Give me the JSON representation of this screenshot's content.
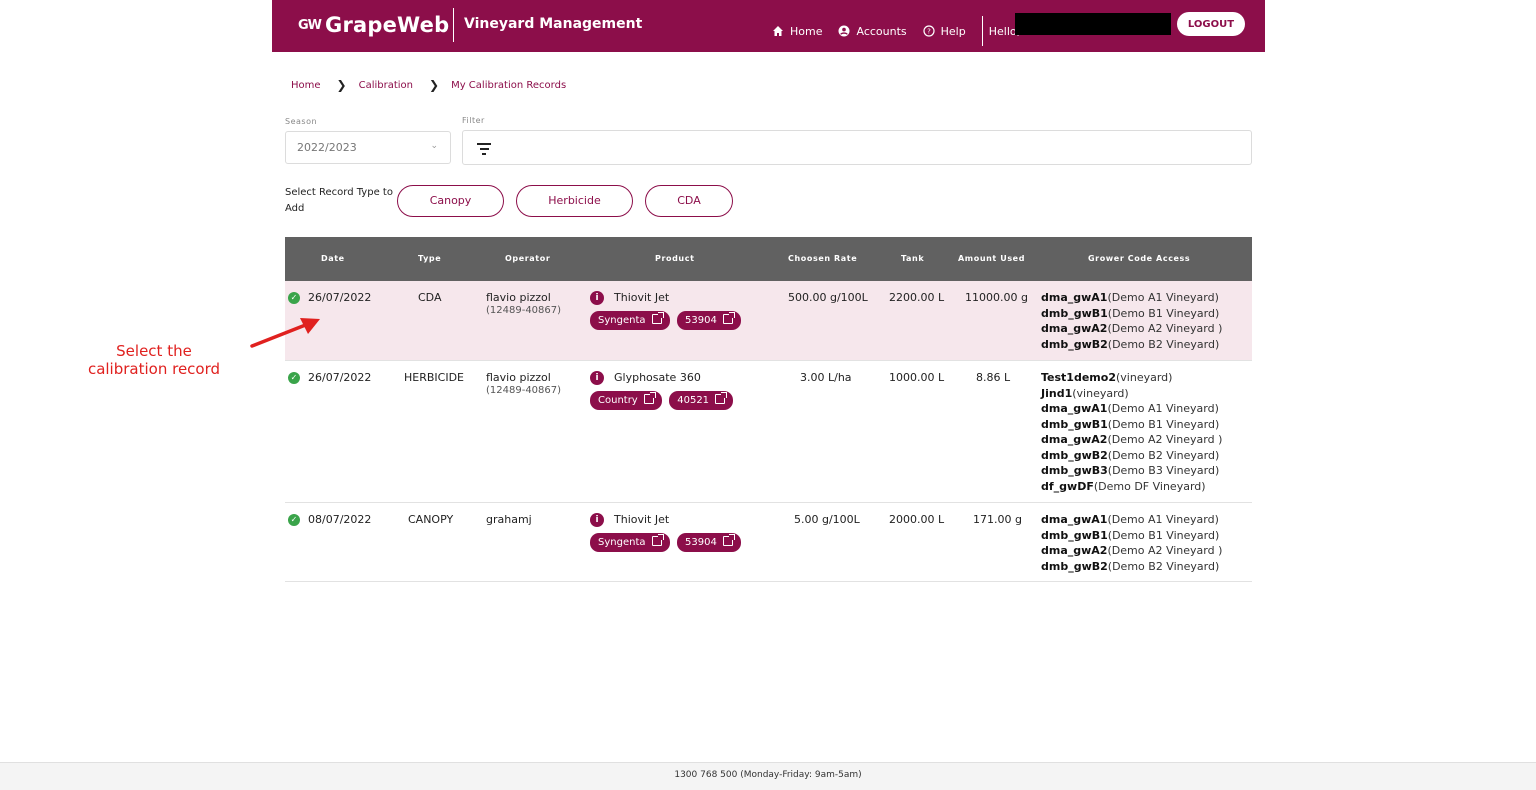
{
  "header": {
    "logo_mark": "GW",
    "logo_text": "GrapeWeb",
    "app_title": "Vineyard Management",
    "nav": [
      {
        "label": "Home",
        "icon": "home-icon"
      },
      {
        "label": "Accounts",
        "icon": "account-icon"
      },
      {
        "label": "Help",
        "icon": "help-icon"
      }
    ],
    "hello": "Hello,",
    "logout": "LOGOUT"
  },
  "breadcrumb": [
    "Home",
    "Calibration",
    "My Calibration Records"
  ],
  "filters": {
    "season_label": "Season",
    "season_value": "2022/2023",
    "filter_label": "Filter"
  },
  "record_type": {
    "label": "Select Record Type to Add",
    "buttons": [
      "Canopy",
      "Herbicide",
      "CDA"
    ]
  },
  "table": {
    "columns": [
      "Date",
      "Type",
      "Operator",
      "Product",
      "Choosen Rate",
      "Tank",
      "Amount Used",
      "Grower Code Access"
    ],
    "rows": [
      {
        "date": "26/07/2022",
        "type": "CDA",
        "operator": "flavio pizzol",
        "operator_sub": "(12489-40867)",
        "product": "Thiovit Jet",
        "tags": [
          "Syngenta",
          "53904"
        ],
        "rate": "500.00 g/100L",
        "tank": "2200.00 L",
        "amount": "11000.00 g",
        "growers": [
          {
            "code": "dma_gwA1",
            "name": "(Demo A1 Vineyard)"
          },
          {
            "code": "dmb_gwB1",
            "name": "(Demo B1 Vineyard)"
          },
          {
            "code": "dma_gwA2",
            "name": "(Demo A2 Vineyard )"
          },
          {
            "code": "dmb_gwB2",
            "name": "(Demo B2 Vineyard)"
          }
        ]
      },
      {
        "date": "26/07/2022",
        "type": "HERBICIDE",
        "operator": "flavio pizzol",
        "operator_sub": "(12489-40867)",
        "product": "Glyphosate 360",
        "tags": [
          "Country",
          "40521"
        ],
        "rate": "3.00 L/ha",
        "tank": "1000.00 L",
        "amount": "8.86 L",
        "growers": [
          {
            "code": "Test1demo2",
            "name": "(vineyard)"
          },
          {
            "code": "Jind1",
            "name": "(vineyard)"
          },
          {
            "code": "dma_gwA1",
            "name": "(Demo A1 Vineyard)"
          },
          {
            "code": "dmb_gwB1",
            "name": "(Demo B1 Vineyard)"
          },
          {
            "code": "dma_gwA2",
            "name": "(Demo A2 Vineyard )"
          },
          {
            "code": "dmb_gwB2",
            "name": "(Demo B2 Vineyard)"
          },
          {
            "code": "dmb_gwB3",
            "name": "(Demo B3 Vineyard)"
          },
          {
            "code": "df_gwDF",
            "name": "(Demo DF Vineyard)"
          }
        ]
      },
      {
        "date": "08/07/2022",
        "type": "CANOPY",
        "operator": "grahamj",
        "operator_sub": "",
        "product": "Thiovit Jet",
        "tags": [
          "Syngenta",
          "53904"
        ],
        "rate": "5.00 g/100L",
        "tank": "2000.00 L",
        "amount": "171.00 g",
        "growers": [
          {
            "code": "dma_gwA1",
            "name": "(Demo A1 Vineyard)"
          },
          {
            "code": "dmb_gwB1",
            "name": "(Demo B1 Vineyard)"
          },
          {
            "code": "dma_gwA2",
            "name": "(Demo A2 Vineyard )"
          },
          {
            "code": "dmb_gwB2",
            "name": "(Demo B2 Vineyard)"
          }
        ]
      }
    ]
  },
  "annotation": "Select the calibration record",
  "footer": "1300 768 500 (Monday-Friday: 9am-5am)",
  "colors": {
    "brand": "#8c0e4a",
    "table_header": "#616161",
    "selected_row": "#f6e7ec",
    "status_ok": "#3aa44a",
    "annotation": "#e0211f"
  }
}
